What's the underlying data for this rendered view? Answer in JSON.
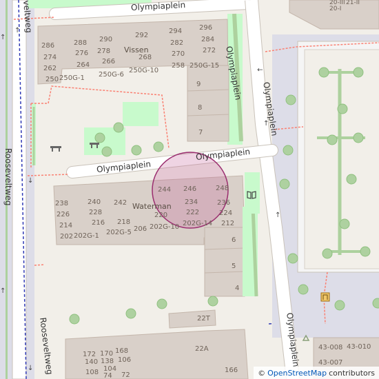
{
  "streets": {
    "olympiaplein_top": "Olympiaplein",
    "olympiaplein_mid_left": "Olympiaplein",
    "olympiaplein_mid_right": "Olympiaplein",
    "olympiaplein_vert_top": "Olympiaplein",
    "olympiaplein_vert_bottom": "Olympiaplein",
    "rooseveltweg_left": "Rooseveltweg",
    "rooseveltweg_bottom": "Rooseveltweg",
    "rooseveltweg_topcut": "veltweg"
  },
  "buildings": {
    "vissen": "Vissen",
    "waterman": "Waterman"
  },
  "house_numbers": {
    "top_block": [
      "286",
      "288",
      "290",
      "292",
      "294",
      "296",
      "276",
      "278",
      "282",
      "284",
      "274",
      "264",
      "266",
      "268",
      "270",
      "272",
      "262",
      "258",
      "250",
      "250G-1",
      "250G-6",
      "250G-10",
      "250G-15",
      "9",
      "8",
      "7"
    ],
    "mid_block": [
      "244",
      "246",
      "248",
      "238",
      "240",
      "242",
      "236",
      "226",
      "228",
      "234",
      "214",
      "216",
      "218",
      "220",
      "222",
      "224",
      "212",
      "206",
      "202",
      "202G-1",
      "202G-5",
      "202G-10",
      "202G-14",
      "6",
      "5",
      "4"
    ],
    "bottom_block": [
      "22T",
      "22A",
      "172",
      "170",
      "168",
      "140",
      "138",
      "106",
      "108",
      "104",
      "74",
      "72",
      "166"
    ],
    "top_right": [
      "20-III",
      "20-I",
      "21-II"
    ],
    "bottom_right": [
      "43-008",
      "43-010",
      "43-007"
    ]
  },
  "colors": {
    "background": "#f2efe9",
    "road": "#ffffff",
    "road_casing": "#c9c2b9",
    "building": "#d9d0c9",
    "building_outline": "#c4b6ab",
    "grass": "#c8facc",
    "strip_green": "#add19e",
    "footway": "#fa8072",
    "tree": "#aed1a0",
    "boundary": "#2f39b5",
    "marker_fill": "#c6649b",
    "marker_stroke": "#9a2d6f",
    "pavement": "#dddde8"
  },
  "icons": [
    "bench-icon",
    "bench-icon",
    "book-icon",
    "playground-icon",
    "recycling-icon",
    "tree-icon"
  ],
  "marker": {
    "name": "location-circle"
  },
  "attribution": {
    "prefix": "©",
    "link": "OpenStreetMap",
    "suffix": "contributors"
  }
}
